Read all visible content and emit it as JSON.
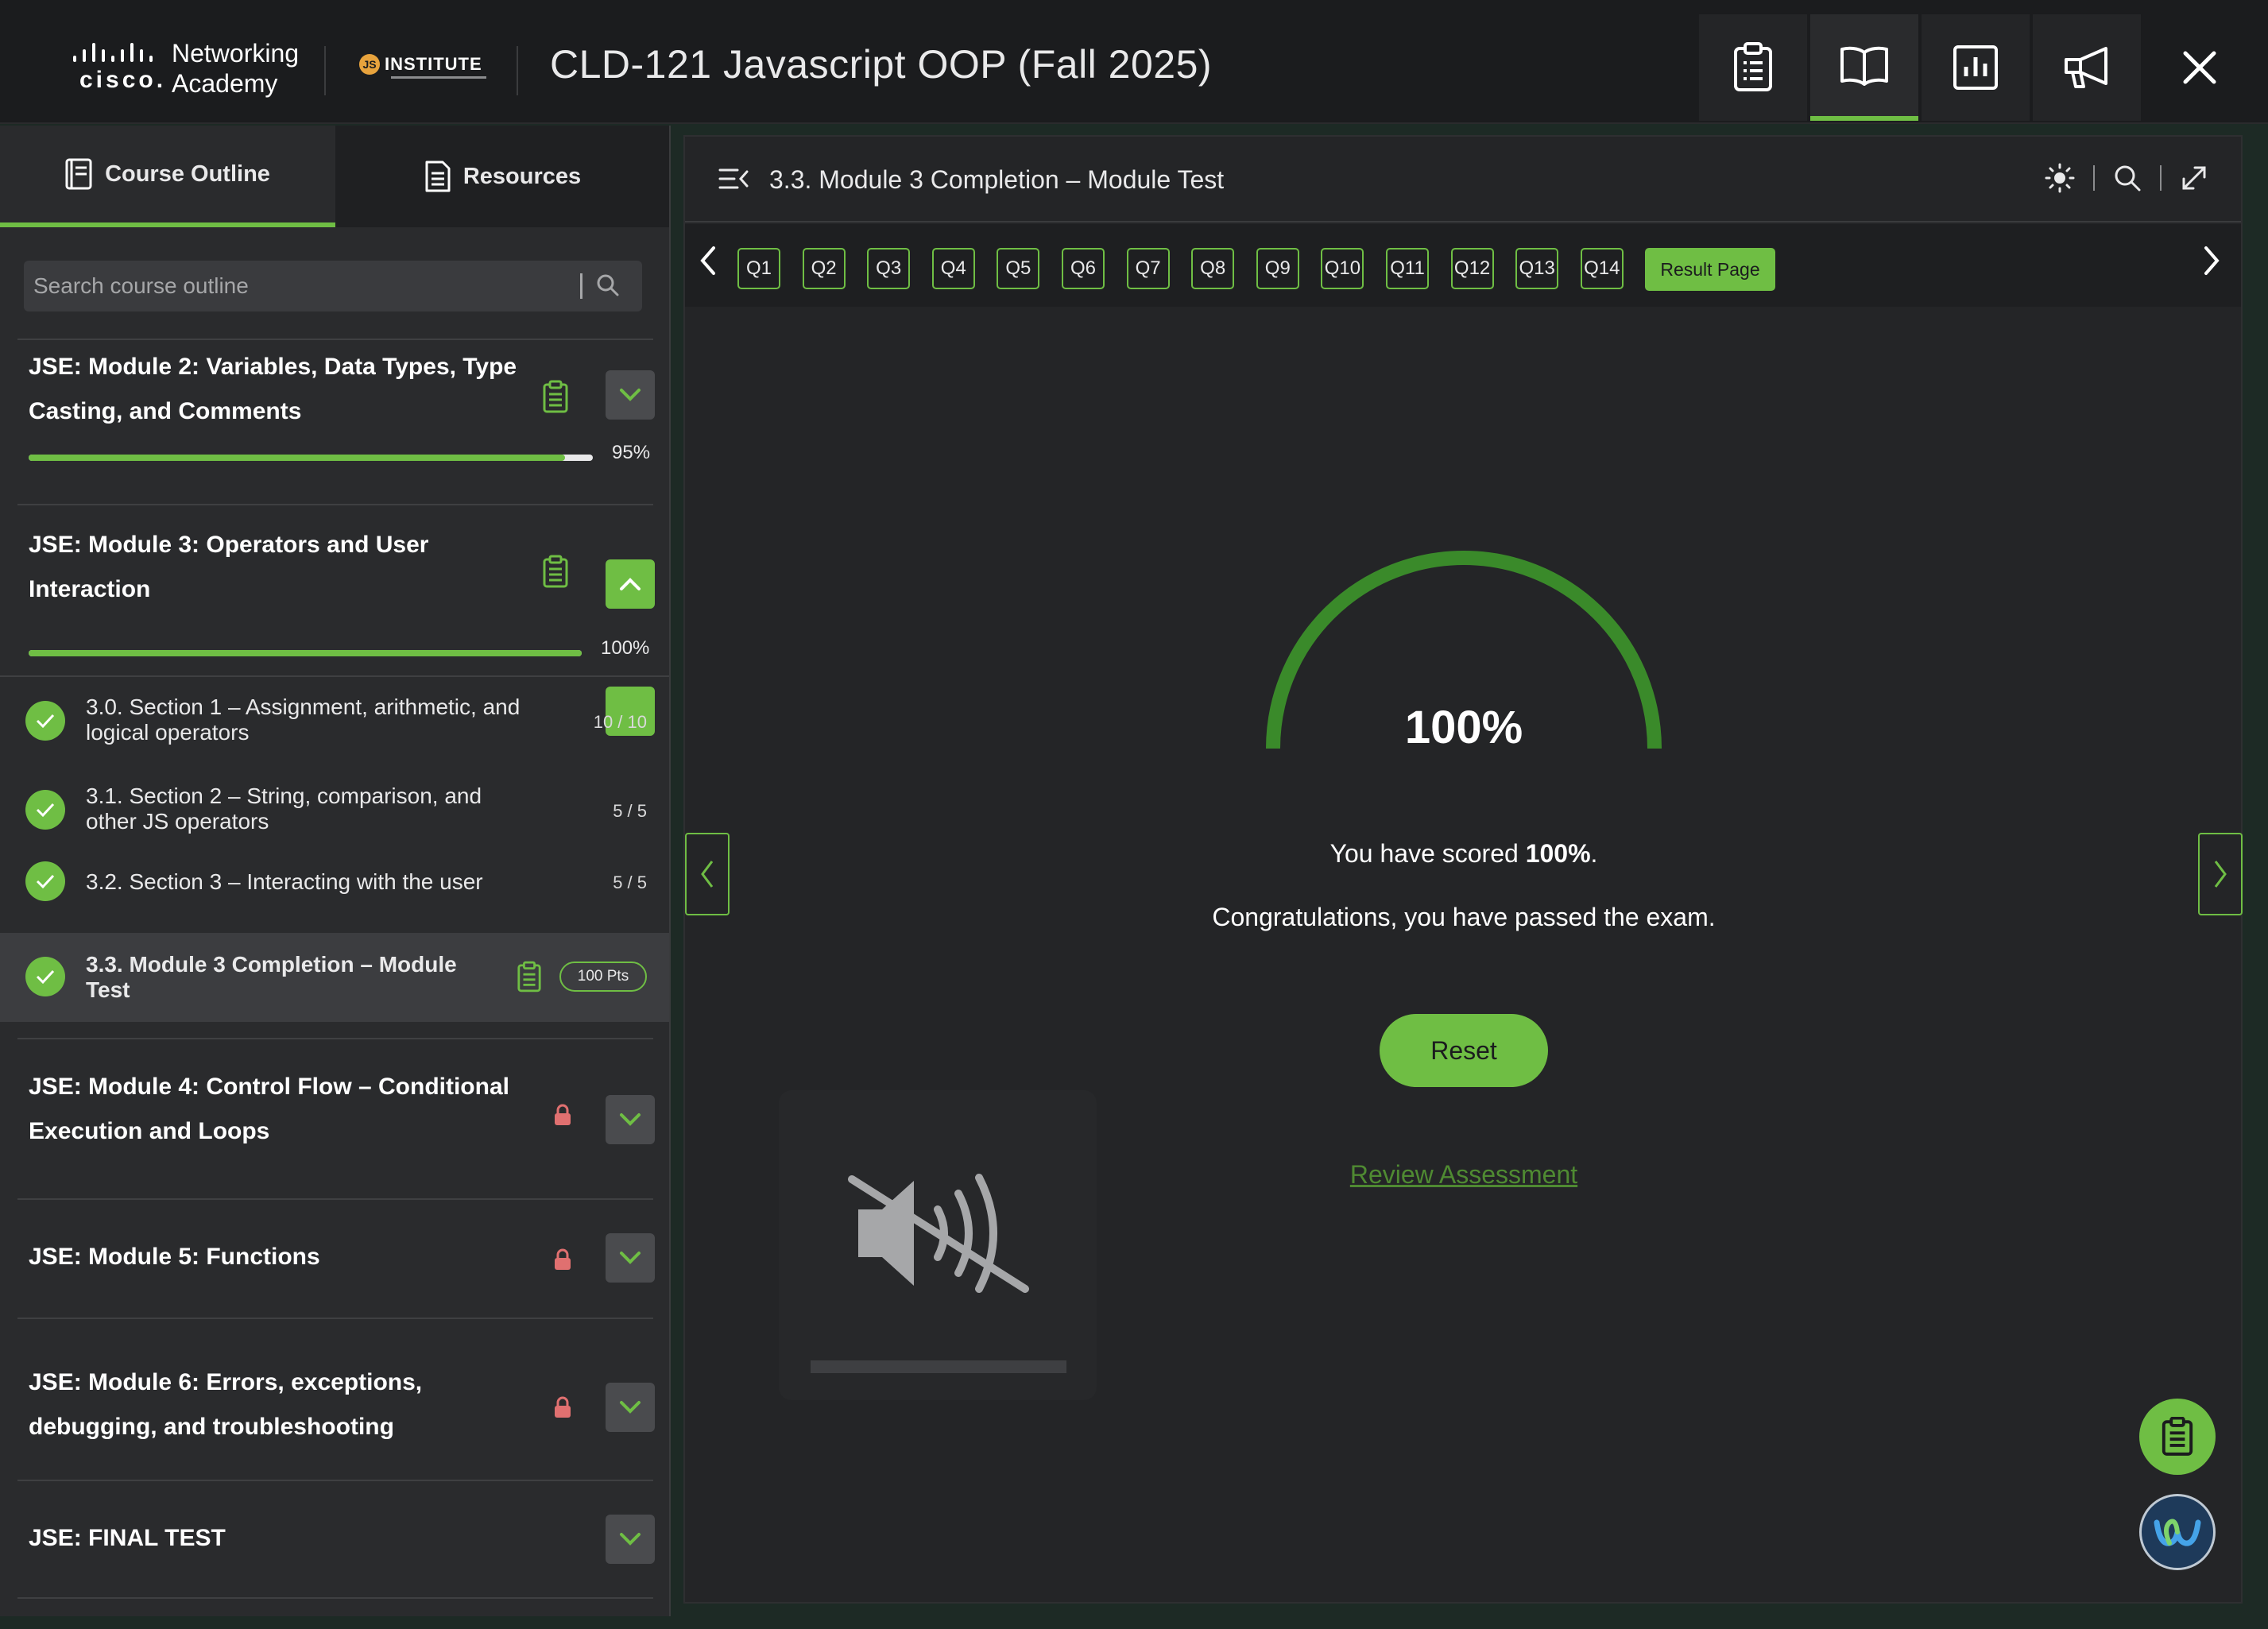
{
  "header": {
    "networking_line1": "Networking",
    "networking_line2": "Academy",
    "cisco_word": "cisco.",
    "institute_badge": "JS",
    "institute_text": "INSTITUTE",
    "course_title": "CLD-121 Javascript OOP (Fall 2025)",
    "buttons": [
      "clipboard-list-icon",
      "book-open-icon",
      "bar-chart-icon",
      "megaphone-icon",
      "close-icon"
    ]
  },
  "sidebar": {
    "tabs": [
      {
        "label": "Course Outline",
        "icon": "outline-icon",
        "active": true
      },
      {
        "label": "Resources",
        "icon": "document-icon",
        "active": false
      }
    ],
    "search_placeholder": "Search course outline",
    "modules": [
      {
        "title": "JSE: Module 2: Variables, Data Types, Type Casting, and Comments",
        "progress_pct": "95%",
        "progress": 0.95,
        "status": "in-progress",
        "expanded": false
      },
      {
        "title": "JSE: Module 3: Operators and User Interaction",
        "progress_pct": "100%",
        "progress": 1.0,
        "status": "complete",
        "expanded": true,
        "items": [
          {
            "label": "3.0. Section 1 – Assignment, arithmetic, and logical operators",
            "score": "10 / 10"
          },
          {
            "label": "3.1. Section 2 – String, comparison, and other JS operators",
            "score": "5 / 5"
          },
          {
            "label": "3.2. Section 3 – Interacting with the user",
            "score": "5 / 5"
          },
          {
            "label": "3.3. Module 3 Completion – Module Test",
            "score": "100 Pts",
            "current": true
          }
        ]
      },
      {
        "title": "JSE: Module 4: Control Flow – Conditional Execution and Loops",
        "status": "locked"
      },
      {
        "title": "JSE: Module 5: Functions",
        "status": "locked"
      },
      {
        "title": "JSE: Module 6: Errors, exceptions, debugging, and troubleshooting",
        "status": "locked"
      },
      {
        "title": "JSE: FINAL TEST",
        "status": "none"
      }
    ]
  },
  "content": {
    "title": "3.3. Module 3 Completion – Module Test",
    "questions": [
      "Q1",
      "Q2",
      "Q3",
      "Q4",
      "Q5",
      "Q6",
      "Q7",
      "Q8",
      "Q9",
      "Q10",
      "Q11",
      "Q12",
      "Q13",
      "Q14"
    ],
    "result_page_label": "Result Page",
    "score_display": "100%",
    "score": 1.0,
    "score_prefix": "You have scored ",
    "score_value": "100%",
    "score_suffix": ".",
    "pass_message": "Congratulations, you have passed the exam.",
    "reset_label": "Reset",
    "review_label": "Review Assessment",
    "audio_state": "muted"
  },
  "colors": {
    "accent": "#6fbe44",
    "background": "#242527",
    "sidebar": "#2a2b2d",
    "locked": "#e07070"
  }
}
